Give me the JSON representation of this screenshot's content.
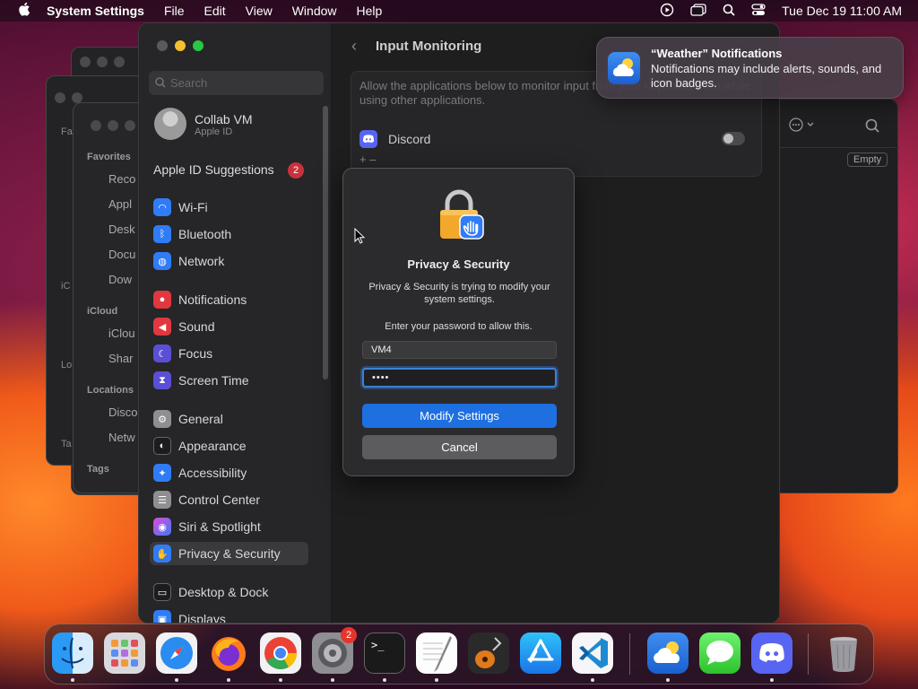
{
  "menubar": {
    "apple": "",
    "app_name": "System Settings",
    "menus": [
      "File",
      "Edit",
      "View",
      "Window",
      "Help"
    ],
    "datetime": "Tue Dec 19  11:00 AM"
  },
  "background_window": {
    "sections": [
      "Favorites",
      "iCloud",
      "Locations",
      "Tags"
    ],
    "items": [
      "Reco",
      "Appl",
      "Desk",
      "Docu",
      "Dow",
      "iClou",
      "Shar",
      "Disco",
      "Netw"
    ],
    "stub_labels": [
      "Fa",
      "iC",
      "Lo",
      "Ta"
    ],
    "empty_label": "Empty"
  },
  "sidebar": {
    "search_placeholder": "Search",
    "account_name": "Collab VM",
    "account_sub": "Apple ID",
    "suggestions_label": "Apple ID Suggestions",
    "suggestions_badge": "2",
    "items": [
      {
        "label": "Wi-Fi",
        "icon": "wifi-icon",
        "color": "#2f7cf6"
      },
      {
        "label": "Bluetooth",
        "icon": "bluetooth-icon",
        "color": "#2f7cf6"
      },
      {
        "label": "Network",
        "icon": "globe-icon",
        "color": "#2f7cf6"
      },
      {
        "label": "Notifications",
        "icon": "bell-icon",
        "color": "#e0383e"
      },
      {
        "label": "Sound",
        "icon": "speaker-icon",
        "color": "#e0383e"
      },
      {
        "label": "Focus",
        "icon": "moon-icon",
        "color": "#5b4fd6"
      },
      {
        "label": "Screen Time",
        "icon": "hourglass-icon",
        "color": "#5b4fd6"
      },
      {
        "label": "General",
        "icon": "gear-icon",
        "color": "#8e8e93"
      },
      {
        "label": "Appearance",
        "icon": "appearance-icon",
        "color": "#1c1c1e"
      },
      {
        "label": "Accessibility",
        "icon": "accessibility-icon",
        "color": "#2f7cf6"
      },
      {
        "label": "Control Center",
        "icon": "control-center-icon",
        "color": "#8e8e93"
      },
      {
        "label": "Siri & Spotlight",
        "icon": "siri-icon",
        "color": "#c54bd6"
      },
      {
        "label": "Privacy & Security",
        "icon": "hand-icon",
        "color": "#2f7cf6"
      },
      {
        "label": "Desktop & Dock",
        "icon": "dock-icon",
        "color": "#1c1c1e"
      },
      {
        "label": "Displays",
        "icon": "display-icon",
        "color": "#2f7cf6"
      }
    ]
  },
  "content": {
    "title": "Input Monitoring",
    "description": "Allow the applications below to monitor input from your keyboard even while using other applications.",
    "apps": [
      {
        "name": "Discord",
        "enabled": false
      }
    ],
    "add_remove": "+  –"
  },
  "dialog": {
    "title": "Privacy & Security",
    "message": "Privacy & Security is trying to modify your system settings.",
    "prompt": "Enter your password to allow this.",
    "username": "VM4",
    "password_mask": "••••",
    "primary_button": "Modify Settings",
    "cancel_button": "Cancel"
  },
  "notification": {
    "title": "“Weather” Notifications",
    "body": "Notifications may include alerts, sounds, and icon badges.",
    "close": "×"
  },
  "dock": {
    "apps": [
      "Finder",
      "Launchpad",
      "Safari",
      "Firefox",
      "Chrome",
      "System Settings",
      "Terminal",
      "TextEdit",
      "GarageBand",
      "App Store",
      "Visual Studio Code",
      "Weather",
      "Messages",
      "Discord",
      "Trash"
    ],
    "settings_badge": "2",
    "terminal_glyph": ">_"
  }
}
